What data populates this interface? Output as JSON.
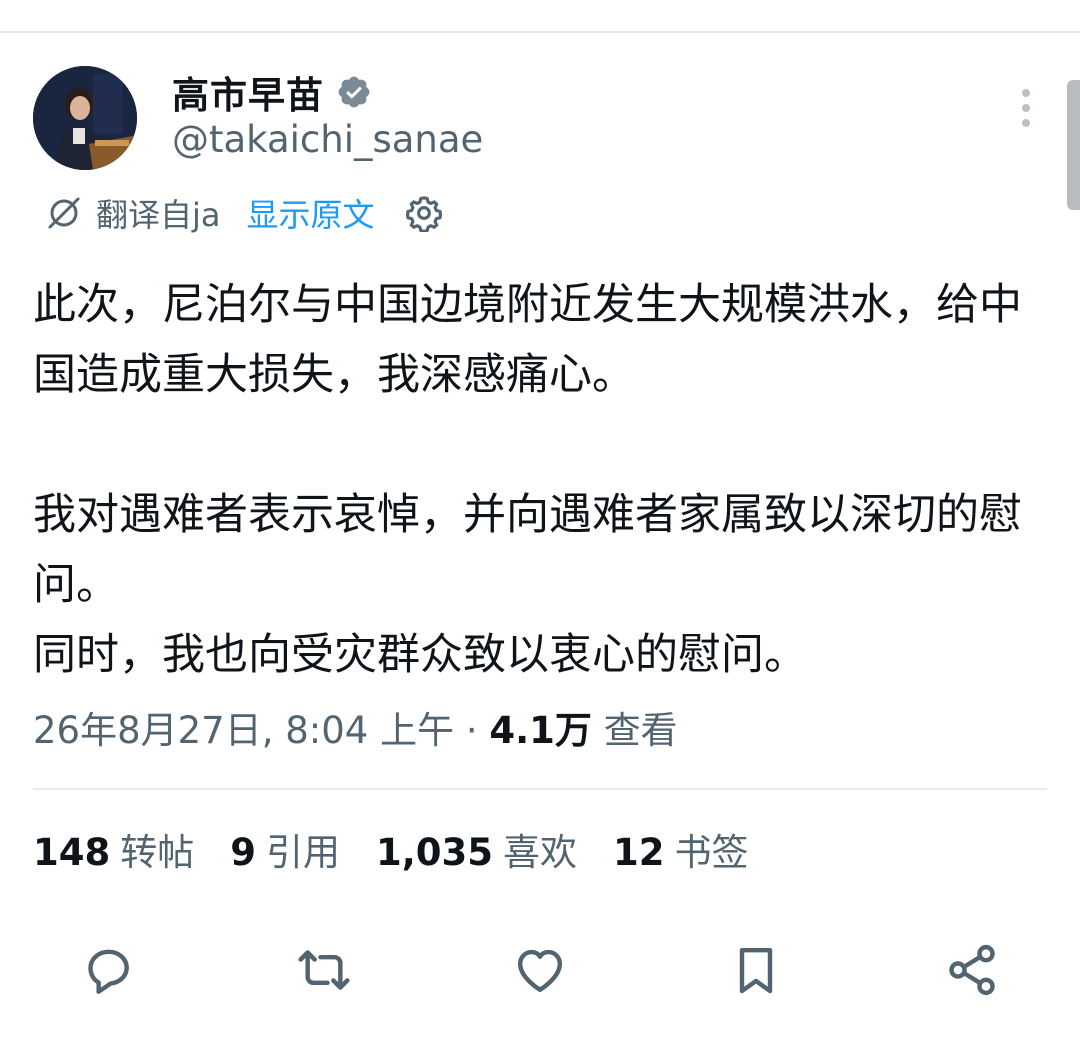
{
  "author": {
    "display_name": "高市早苗",
    "handle": "@takaichi_sanae",
    "verified": true
  },
  "translation": {
    "translated_from": "翻译自ja",
    "show_original": "显示原文"
  },
  "tweet": {
    "paragraph1": "此次，尼泊尔与中国边境附近发生大规模洪水，给中国造成重大损失，我深感痛心。",
    "paragraph2_line1": "我对遇难者表示哀悼，并向遇难者家属致以深切的慰问。",
    "paragraph2_line2": "同时，我也向受灾群众致以衷心的慰问。"
  },
  "meta": {
    "timestamp": "26年8月27日, 8:04 上午",
    "separator": " · ",
    "views_count": "4.1万",
    "views_label": "查看"
  },
  "stats": {
    "reposts": {
      "count": "148",
      "label": "转帖"
    },
    "quotes": {
      "count": "9",
      "label": "引用"
    },
    "likes": {
      "count": "1,035",
      "label": "喜欢"
    },
    "bookmarks": {
      "count": "12",
      "label": "书签"
    }
  },
  "colors": {
    "text_primary": "#0f1419",
    "text_secondary": "#536471",
    "link_blue": "#1d9bf0",
    "verified_badge": "#7b8a97",
    "divider": "#e6e9ec"
  },
  "icons": {
    "verified": "verified-badge-icon",
    "more": "more-vertical-icon",
    "translate": "translate-icon",
    "settings": "gear-icon",
    "reply": "reply-icon",
    "repost": "repost-icon",
    "like": "heart-icon",
    "bookmark": "bookmark-icon",
    "share": "share-icon"
  }
}
